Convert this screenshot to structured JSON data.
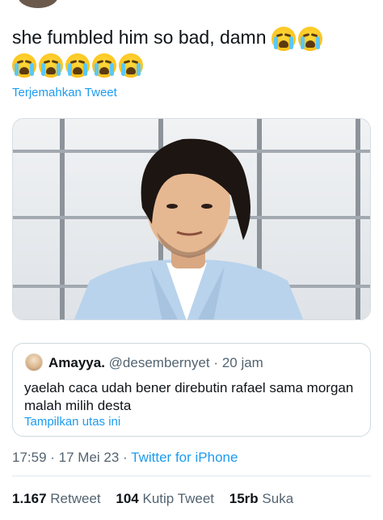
{
  "tweet": {
    "text": "she fumbled him so bad, damn",
    "emoji_line1": [
      "crying-face-emoji",
      "crying-face-emoji"
    ],
    "emoji_line2": [
      "crying-face-emoji",
      "crying-face-emoji",
      "crying-face-emoji",
      "crying-face-emoji",
      "crying-face-emoji"
    ],
    "translate_label": "Terjemahkan Tweet"
  },
  "quoted_tweet": {
    "name": "Amayya.",
    "handle": "@desembernyet",
    "separator": "·",
    "time": "20 jam",
    "text": "yaelah caca udah bener direbutin rafael sama morgan malah milih desta",
    "show_thread_label": "Tampilkan utas ini"
  },
  "meta": {
    "time": "17:59",
    "date": "17 Mei 23",
    "source": "Twitter for iPhone"
  },
  "stats": {
    "retweets_count": "1.167",
    "retweets_label": "Retweet",
    "quotes_count": "104",
    "quotes_label": "Kutip Tweet",
    "likes_count": "15rb",
    "likes_label": "Suka"
  },
  "colors": {
    "link": "#1d9bf0",
    "text": "#0f1419",
    "secondary": "#536471",
    "border": "#cfd9de"
  }
}
